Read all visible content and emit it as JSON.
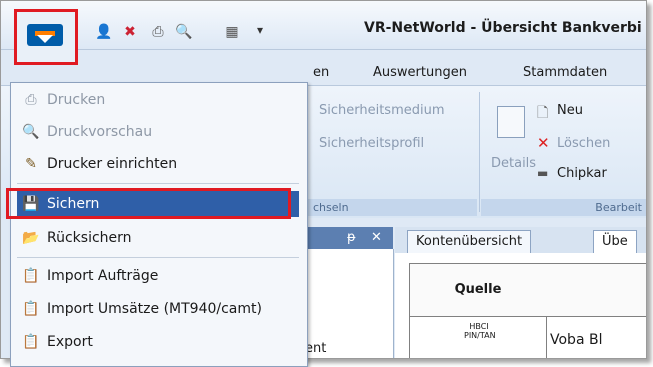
{
  "window": {
    "title": "VR-NetWorld - Übersicht Bankverbi"
  },
  "quick_access": {
    "icons": [
      "user-icon",
      "disconnect-icon",
      "printer-icon",
      "print-preview-icon",
      "window-icon"
    ],
    "more": "▾"
  },
  "ribbon_tabs": [
    "en",
    "Auswertungen",
    "Stammdaten"
  ],
  "ribbon": {
    "security_medium": "Sicherheitsmedium",
    "security_profile": "Sicherheitsprofil",
    "details": "Details",
    "new": "Neu",
    "delete": "Löschen",
    "chipcard": "Chipkar",
    "group_switch": "chseln",
    "group_edit": "Bearbeit"
  },
  "menu": {
    "items": [
      {
        "label": "Drucken",
        "icon": "printer-icon",
        "disabled": true
      },
      {
        "label": "Druckvorschau",
        "icon": "print-preview-icon",
        "disabled": true
      },
      {
        "label": "Drucker einrichten",
        "icon": "printer-setup-icon",
        "disabled": false
      },
      {
        "label": "Sichern",
        "icon": "save-icon",
        "disabled": false,
        "selected": true
      },
      {
        "label": "Rücksichern",
        "icon": "restore-folder-icon",
        "disabled": false
      },
      {
        "label": "Import Aufträge",
        "icon": "import-icon",
        "disabled": false
      },
      {
        "label": "Import Umsätze (MT940/camt)",
        "icon": "import-icon",
        "disabled": false
      },
      {
        "label": "Export",
        "icon": "export-icon",
        "disabled": false
      }
    ]
  },
  "left_pane": {
    "pin": "ᵽ",
    "close": "✕",
    "partial_text": "ent"
  },
  "doc_tabs": [
    "Kontenübersicht",
    "Übe"
  ],
  "table": {
    "header": "Quelle",
    "row1_source_label": "HBCI PIN/TAN",
    "row1_bank": "Voba Bl"
  }
}
